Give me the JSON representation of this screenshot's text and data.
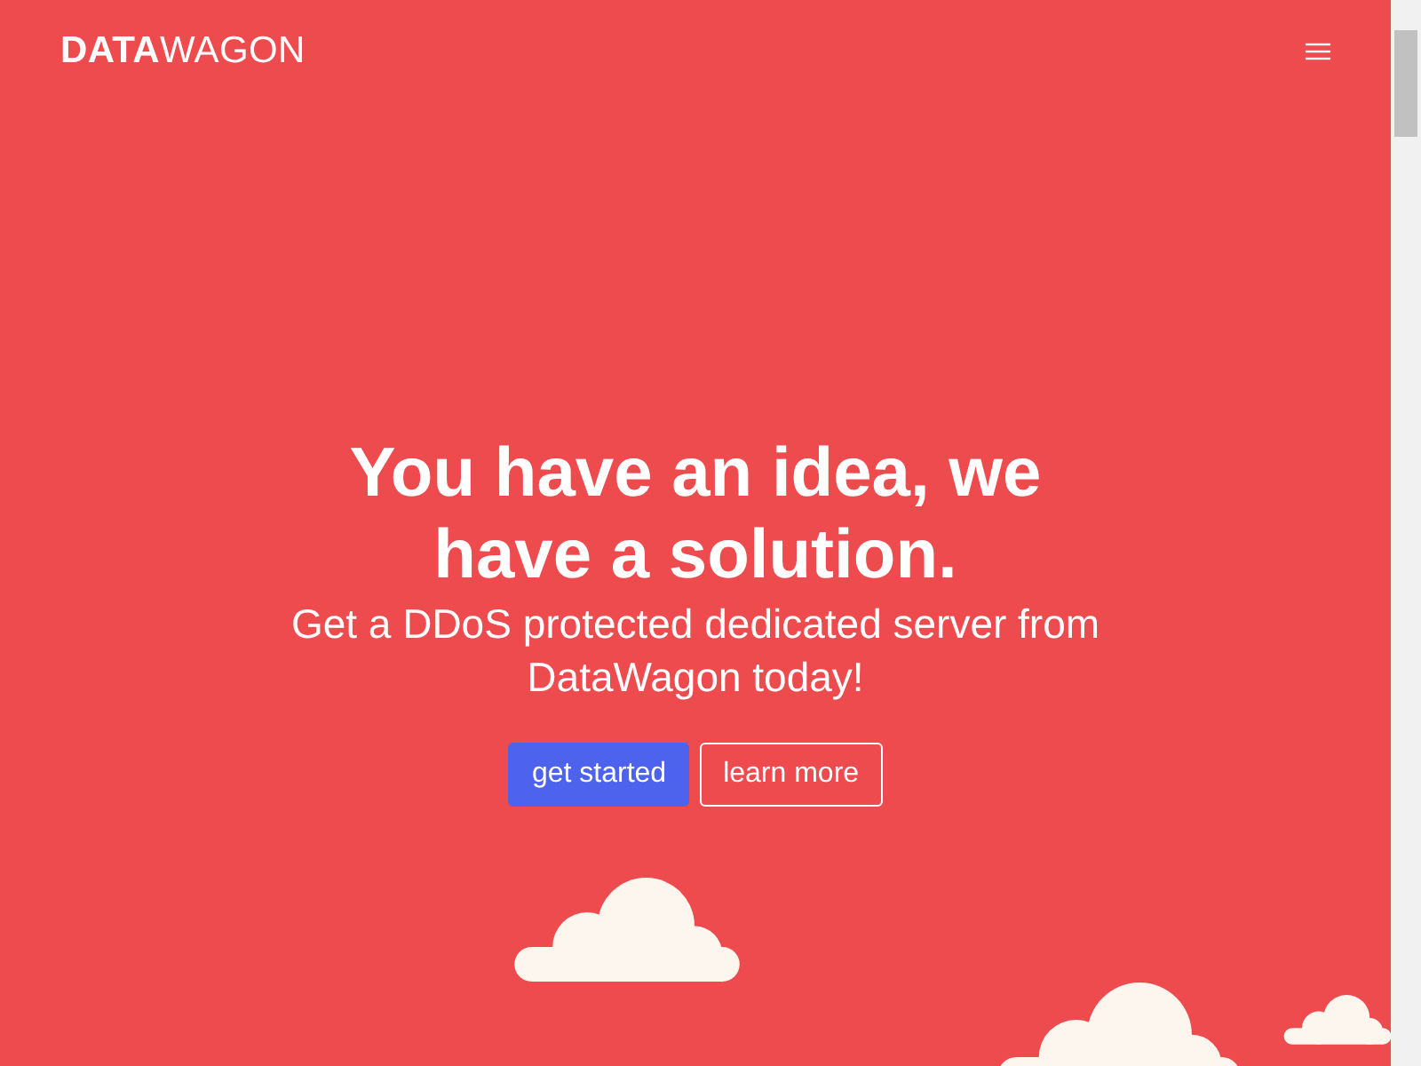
{
  "header": {
    "logo": "**DATA**WAGON"
  },
  "hero": {
    "title": "You have an idea, we have a solution.",
    "subtitle": "Get a DDoS protected dedicated server from DataWagon today!",
    "buttons": [
      {
        "label": "get started",
        "kind": "primary"
      },
      {
        "label": "learn more",
        "kind": "outline"
      }
    ]
  }
}
